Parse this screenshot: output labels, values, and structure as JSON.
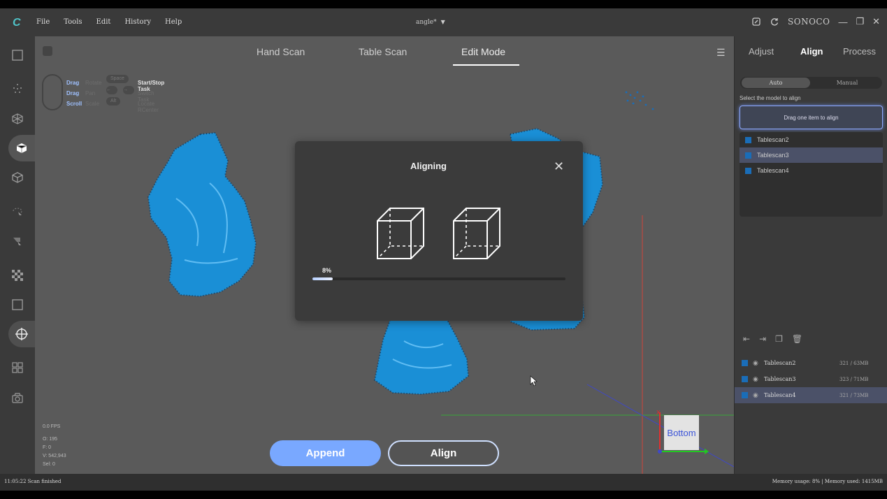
{
  "menu": [
    "File",
    "Tools",
    "Edit",
    "History",
    "Help"
  ],
  "document": {
    "title": "angle*"
  },
  "brand": "SONOCO",
  "tabs": {
    "hand_scan": "Hand Scan",
    "table_scan": "Table Scan",
    "edit_mode": "Edit Mode"
  },
  "hints": {
    "drag1": "Drag",
    "drag1_action": "Rotate",
    "key_space": "Space",
    "start_stop": "Start/Stop Task",
    "drag2": "Drag",
    "drag2_action": "Pan",
    "switch_task": "Switch Task",
    "scroll": "Scroll",
    "scroll_action": "Scale",
    "key_alt": "Alt",
    "locate": "Locate RCenter"
  },
  "stats": {
    "fps": "0.0 FPS",
    "o": "O: 195",
    "f": "F: 0",
    "v": "V: 542,943",
    "sel": "Sel: 0"
  },
  "buttons": {
    "append": "Append",
    "align": "Align"
  },
  "orientation_cube": "Bottom",
  "dialog": {
    "title": "Aligning",
    "progress_label": "8%",
    "progress": 0.08
  },
  "right_panel": {
    "tabs": [
      "Adjust",
      "Align",
      "Process"
    ],
    "mode_auto": "Auto",
    "mode_manual": "Manual",
    "select_label": "Select the model to align",
    "drop_hint": "Drag one item to align",
    "align_items": [
      "Tablescan2",
      "Tablescan3",
      "Tablescan4"
    ],
    "models": [
      {
        "name": "Tablescan2",
        "size": "321 / 63MB"
      },
      {
        "name": "Tablescan3",
        "size": "323 / 71MB"
      },
      {
        "name": "Tablescan4",
        "size": "321 / 73MB"
      }
    ]
  },
  "status": {
    "left": "11:05:22 Scan finished",
    "right": "Memory usage: 8% | Memory used: 1415MB"
  },
  "colors": {
    "scan_blue": "#1a8fd6",
    "accent": "#79a8ff"
  }
}
